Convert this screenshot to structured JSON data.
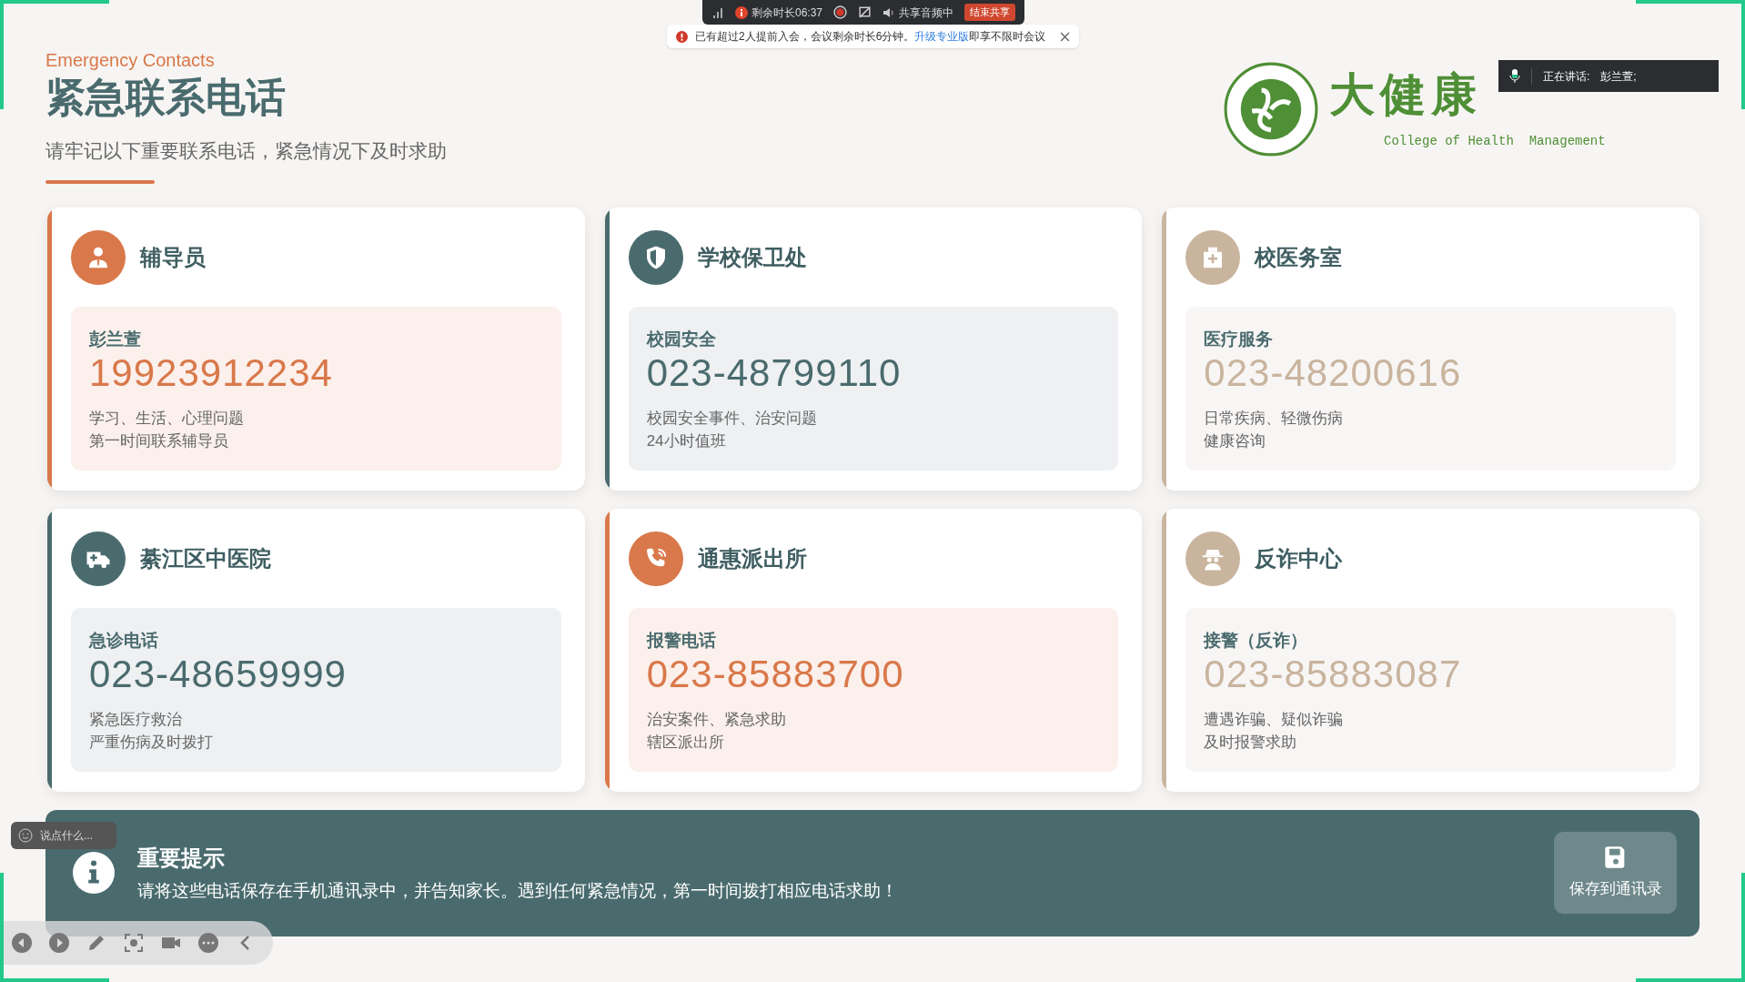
{
  "meeting_bar": {
    "remaining": "剩余时长06:37",
    "audio": "共享音频中",
    "end_button": "结束共享"
  },
  "notice": {
    "text": "已有超过2人提前入会，会议剩余时长6分钟。",
    "link": "升级专业版",
    "suffix": "即享不限时会议"
  },
  "header": {
    "subtitle_en": "Emergency Contacts",
    "title": "紧急联系电话",
    "description": "请牢记以下重要联系电话，紧急情况下及时求助"
  },
  "logo": {
    "name": "大健康",
    "english": "College of Health  Management"
  },
  "speaker": {
    "label": "正在讲话:",
    "name": "彭兰萱;"
  },
  "contacts": [
    {
      "kind": "orange",
      "title": "辅导员",
      "label": "彭兰萱",
      "phone": "19923912234",
      "notes": [
        "学习、生活、心理问题",
        "第一时间联系辅导员"
      ]
    },
    {
      "kind": "teal",
      "title": "学校保卫处",
      "label": "校园安全",
      "phone": "023-48799110",
      "notes": [
        "校园安全事件、治安问题",
        "24小时值班"
      ]
    },
    {
      "kind": "sand",
      "title": "校医务室",
      "label": "医疗服务",
      "phone": "023-48200616",
      "notes": [
        "日常疾病、轻微伤病",
        "健康咨询"
      ]
    },
    {
      "kind": "teal",
      "title": "綦江区中医院",
      "label": "急诊电话",
      "phone": "023-48659999",
      "notes": [
        "紧急医疗救治",
        "严重伤病及时拨打"
      ]
    },
    {
      "kind": "orange",
      "title": "通惠派出所",
      "label": "报警电话",
      "phone": "023-85883700",
      "notes": [
        "治安案件、紧急求助",
        "辖区派出所"
      ]
    },
    {
      "kind": "sand",
      "title": "反诈中心",
      "label": "接警（反诈）",
      "phone": "023-85883087",
      "notes": [
        "遭遇诈骗、疑似诈骗",
        "及时报警求助"
      ]
    }
  ],
  "tip": {
    "title": "重要提示",
    "text": "请将这些电话保存在手机通讯录中，并告知家长。遇到任何紧急情况，第一时间拨打相应电话求助！",
    "button": "保存到通讯录"
  },
  "chat": {
    "placeholder": "说点什么..."
  }
}
